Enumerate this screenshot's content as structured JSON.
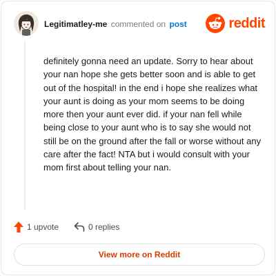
{
  "comment": {
    "username": "Legitimatley-me",
    "action_text": "commented on",
    "post_link_label": "post",
    "text": "definitely gonna need an update. Sorry to hear about your nan hope she gets better soon and is able to get out of the hospital! in the end i hope she realizes what your aunt is doing as your mom seems to be doing more then your aunt ever did. if your nan fell while being close to your aunt who is to say she would not still be on the ground after the fall or worse without any care after the fact! NTA but i would consult with your mom first about telling your nan.",
    "upvotes": "1 upvote",
    "replies": "0 replies"
  },
  "brand": {
    "name": "reddit",
    "icon": "reddit-snoo-icon",
    "color": "#ff4500"
  },
  "actions": {
    "view_label": "View more on Reddit"
  },
  "colors": {
    "upvote": "#ff4500",
    "link": "#0079d3",
    "button_text": "#d93a00"
  },
  "icons": {
    "avatar": "avatar",
    "upvote": "upvote-arrow-icon",
    "reply": "reply-arrow-icon"
  }
}
